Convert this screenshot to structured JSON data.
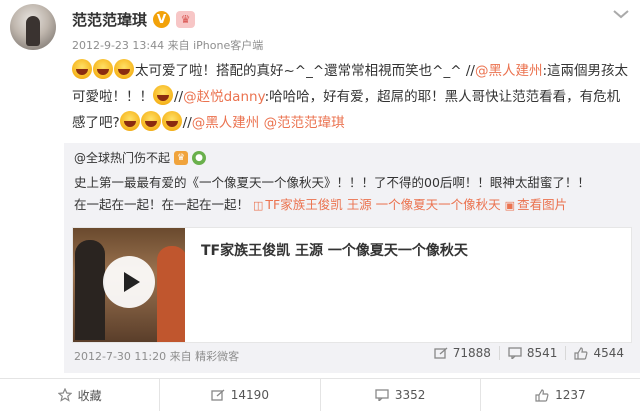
{
  "post": {
    "username": "范范范瑋琪",
    "verified_badge": "V",
    "member_badge": "♛",
    "timestamp": "2012-9-23 13:44",
    "source": "来自 iPhone客户端",
    "text": {
      "seg1": "太可爱了啦！搭配的真好~^_^還常常相視而笑也^_^ //",
      "mention1": "@黑人建州",
      "seg2": ":這兩個男孩太可愛啦！！！",
      "seg3": "//",
      "mention2": "@赵悦danny",
      "seg4": ":哈哈哈，好有爱，超屌的耶！黑人哥快让范范看看，有危机感了吧?",
      "seg5": "//",
      "mention3": "@黑人建州",
      "mention4": "@范范范瑋琪"
    }
  },
  "repost": {
    "author": "@全球热门伤不起",
    "line1": "史上第一最最有爱的《一个像夏天一个像秋天》！！！了不得的00后啊！！眼神太甜蜜了！！",
    "line2_text": "在一起在一起！在一起在一起！",
    "video_link": "TF家族王俊凯 王源 一个像夏天一个像秋天",
    "view_image": "查看图片",
    "card_title": "TF家族王俊凯 王源 一个像夏天一个像秋天",
    "timestamp": "2012-7-30 11:20",
    "source": "来自 精彩微客",
    "reposts": "71888",
    "comments": "8541",
    "likes": "4544"
  },
  "actions": {
    "favorite": "收藏",
    "repost": "14190",
    "comment": "3352",
    "like": "1237"
  },
  "icons": {
    "chevron": "chevron-down-icon",
    "repost": "repost-icon",
    "comment": "comment-icon",
    "like": "thumbs-up-icon",
    "favorite": "star-icon",
    "play": "play-icon"
  },
  "colors": {
    "link": "#eb7350",
    "repost_bg": "#f2f2f5",
    "muted": "#8e8e8e"
  }
}
